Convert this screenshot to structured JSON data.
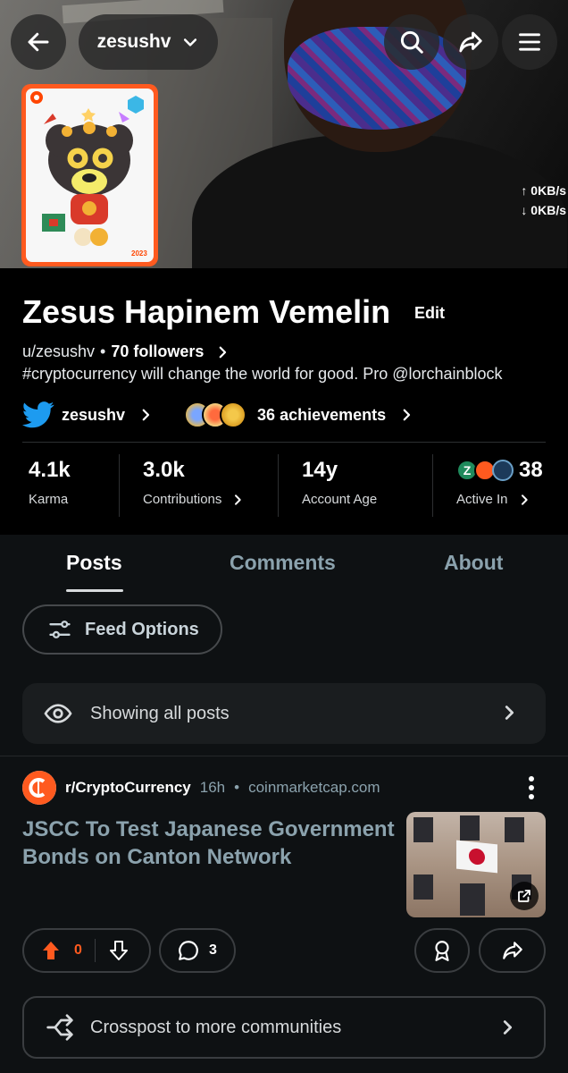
{
  "header": {
    "username_pill": "zesushv",
    "upload_speed": "↑ 0KB/s",
    "download_speed": "↓ 0KB/s"
  },
  "avatar": {
    "year_tag": "2023"
  },
  "profile": {
    "display_name": "Zesus Hapinem Vemelin",
    "edit_label": "Edit",
    "handle": "u/zesushv",
    "separator": "•",
    "followers": "70 followers",
    "bio": "#cryptocurrency will change the world for good. Pro @lorchainblock",
    "twitter_handle": "zesushv",
    "achievements": "36 achievements"
  },
  "stats": [
    {
      "value": "4.1k",
      "label": "Karma"
    },
    {
      "value": "3.0k",
      "label": "Contributions"
    },
    {
      "value": "14y",
      "label": "Account Age"
    },
    {
      "value": "38",
      "label": "Active In"
    }
  ],
  "tabs": {
    "posts": "Posts",
    "comments": "Comments",
    "about": "About"
  },
  "feed_options_label": "Feed Options",
  "showing_label": "Showing all posts",
  "post": {
    "subreddit": "r/CryptoCurrency",
    "age": "16h",
    "dot": "•",
    "domain": "coinmarketcap.com",
    "title": "JSCC To Test Japanese Government Bonds on Canton Network",
    "vote_count": "0",
    "comment_count": "3"
  },
  "crosspost_label": "Crosspost to more communities",
  "colors": {
    "accent": "#ff5a1f",
    "twitter": "#1d9bf0",
    "muted": "#8ba2ad"
  }
}
